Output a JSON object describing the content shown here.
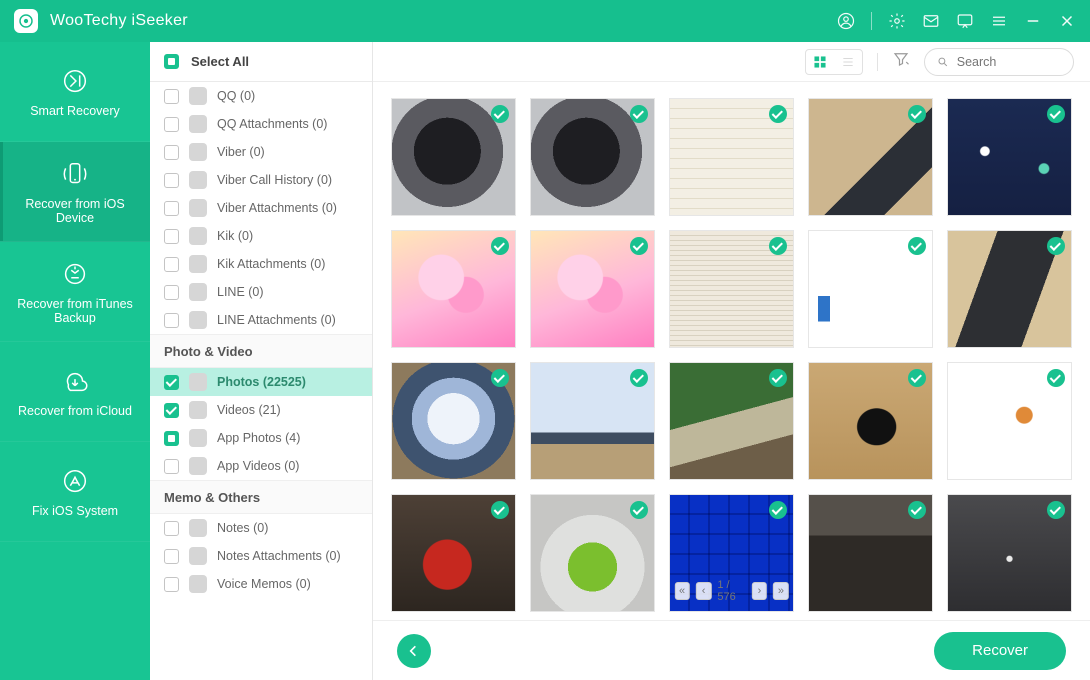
{
  "app": {
    "title": "WooTechy iSeeker"
  },
  "nav": {
    "items": [
      {
        "label": "Smart Recovery",
        "name": "nav-smart-recovery"
      },
      {
        "label": "Recover from iOS Device",
        "name": "nav-recover-ios-device"
      },
      {
        "label": "Recover from iTunes Backup",
        "name": "nav-recover-itunes"
      },
      {
        "label": "Recover from iCloud",
        "name": "nav-recover-icloud"
      },
      {
        "label": "Fix iOS System",
        "name": "nav-fix-ios"
      }
    ],
    "selected_index": 1
  },
  "categories": {
    "select_all_label": "Select All",
    "select_all_state": "indet",
    "ungrouped": [
      {
        "label": "QQ (0)",
        "state": "unchecked"
      },
      {
        "label": "QQ Attachments (0)",
        "state": "unchecked"
      },
      {
        "label": "Viber (0)",
        "state": "unchecked"
      },
      {
        "label": "Viber Call History (0)",
        "state": "unchecked"
      },
      {
        "label": "Viber Attachments (0)",
        "state": "unchecked"
      },
      {
        "label": "Kik (0)",
        "state": "unchecked"
      },
      {
        "label": "Kik Attachments (0)",
        "state": "unchecked"
      },
      {
        "label": "LINE (0)",
        "state": "unchecked"
      },
      {
        "label": "LINE Attachments (0)",
        "state": "unchecked"
      }
    ],
    "groups": [
      {
        "title": "Photo & Video",
        "items": [
          {
            "label": "Photos (22525)",
            "state": "checked",
            "selected": true
          },
          {
            "label": "Videos (21)",
            "state": "checked"
          },
          {
            "label": "App Photos (4)",
            "state": "indet"
          },
          {
            "label": "App Videos (0)",
            "state": "unchecked"
          }
        ]
      },
      {
        "title": "Memo & Others",
        "items": [
          {
            "label": "Notes (0)",
            "state": "unchecked"
          },
          {
            "label": "Notes Attachments (0)",
            "state": "unchecked"
          },
          {
            "label": "Voice Memos (0)",
            "state": "unchecked"
          }
        ]
      }
    ]
  },
  "toolbar": {
    "search_placeholder": "Search"
  },
  "grid": {
    "thumbs": [
      {
        "cls": "fan"
      },
      {
        "cls": "fan"
      },
      {
        "cls": "paper"
      },
      {
        "cls": "laptop"
      },
      {
        "cls": "mousepad"
      },
      {
        "cls": "anime"
      },
      {
        "cls": "anime"
      },
      {
        "cls": "docpage"
      },
      {
        "cls": "shelf"
      },
      {
        "cls": "mblaptop"
      },
      {
        "cls": "monitor"
      },
      {
        "cls": "monitor2"
      },
      {
        "cls": "plant"
      },
      {
        "cls": "mouse"
      },
      {
        "cls": "sim"
      },
      {
        "cls": "red"
      },
      {
        "cls": "green"
      },
      {
        "cls": "keyboard",
        "pager": true
      },
      {
        "cls": "dark1"
      },
      {
        "cls": "dark2"
      }
    ],
    "pager": {
      "page": "1",
      "total": "576"
    }
  },
  "footer": {
    "recover_label": "Recover"
  }
}
